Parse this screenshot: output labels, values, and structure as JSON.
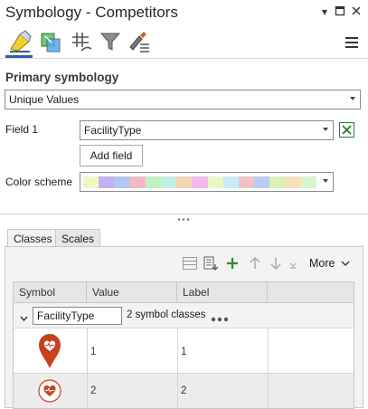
{
  "pane": {
    "title": "Symbology - Competitors",
    "window_buttons": [
      "dropdown-icon",
      "maximize-icon",
      "close-icon"
    ]
  },
  "tabs": [
    {
      "name": "primary-symbology-tab",
      "icon": "paint-bucket-icon",
      "active": true
    },
    {
      "name": "vary-symbology-tab",
      "icon": "layers-icon"
    },
    {
      "name": "symbol-layer-drawing-tab",
      "icon": "grid-draw-icon"
    },
    {
      "name": "masking-tab",
      "icon": "funnel-icon"
    },
    {
      "name": "advanced-symbology-tab",
      "icon": "brush-list-icon"
    }
  ],
  "primary": {
    "heading": "Primary symbology",
    "method": "Unique Values",
    "field1_label": "Field 1",
    "field1_value": "FacilityType",
    "add_field_label": "Add field",
    "color_scheme_label": "Color scheme",
    "color_scheme_colors": [
      "#f2f7c2",
      "#c4b1f5",
      "#b1c9f2",
      "#f5b8c9",
      "#bff2bf",
      "#c3f0e6",
      "#f6d3b3",
      "#f7b7f0",
      "#e9f7c9",
      "#c7ecf5",
      "#f5c2c2",
      "#b9cdf5",
      "#d9f2b7",
      "#f5e3b7",
      "#d6f5d0"
    ]
  },
  "classes": {
    "tabs": [
      "Classes",
      "Scales"
    ],
    "more_label": "More",
    "columns": [
      "Symbol",
      "Value",
      "Label"
    ],
    "group_field": "FacilityType",
    "group_count": "2 symbol classes",
    "rows": [
      {
        "value": "1",
        "label": "1",
        "symbol": "heart-pin-icon"
      },
      {
        "value": "2",
        "label": "2",
        "symbol": "heart-circle-icon"
      }
    ]
  },
  "colors": {
    "accent": "#2c5ea8",
    "symbol_red": "#c8401e",
    "add_green": "#2e8b2e"
  }
}
